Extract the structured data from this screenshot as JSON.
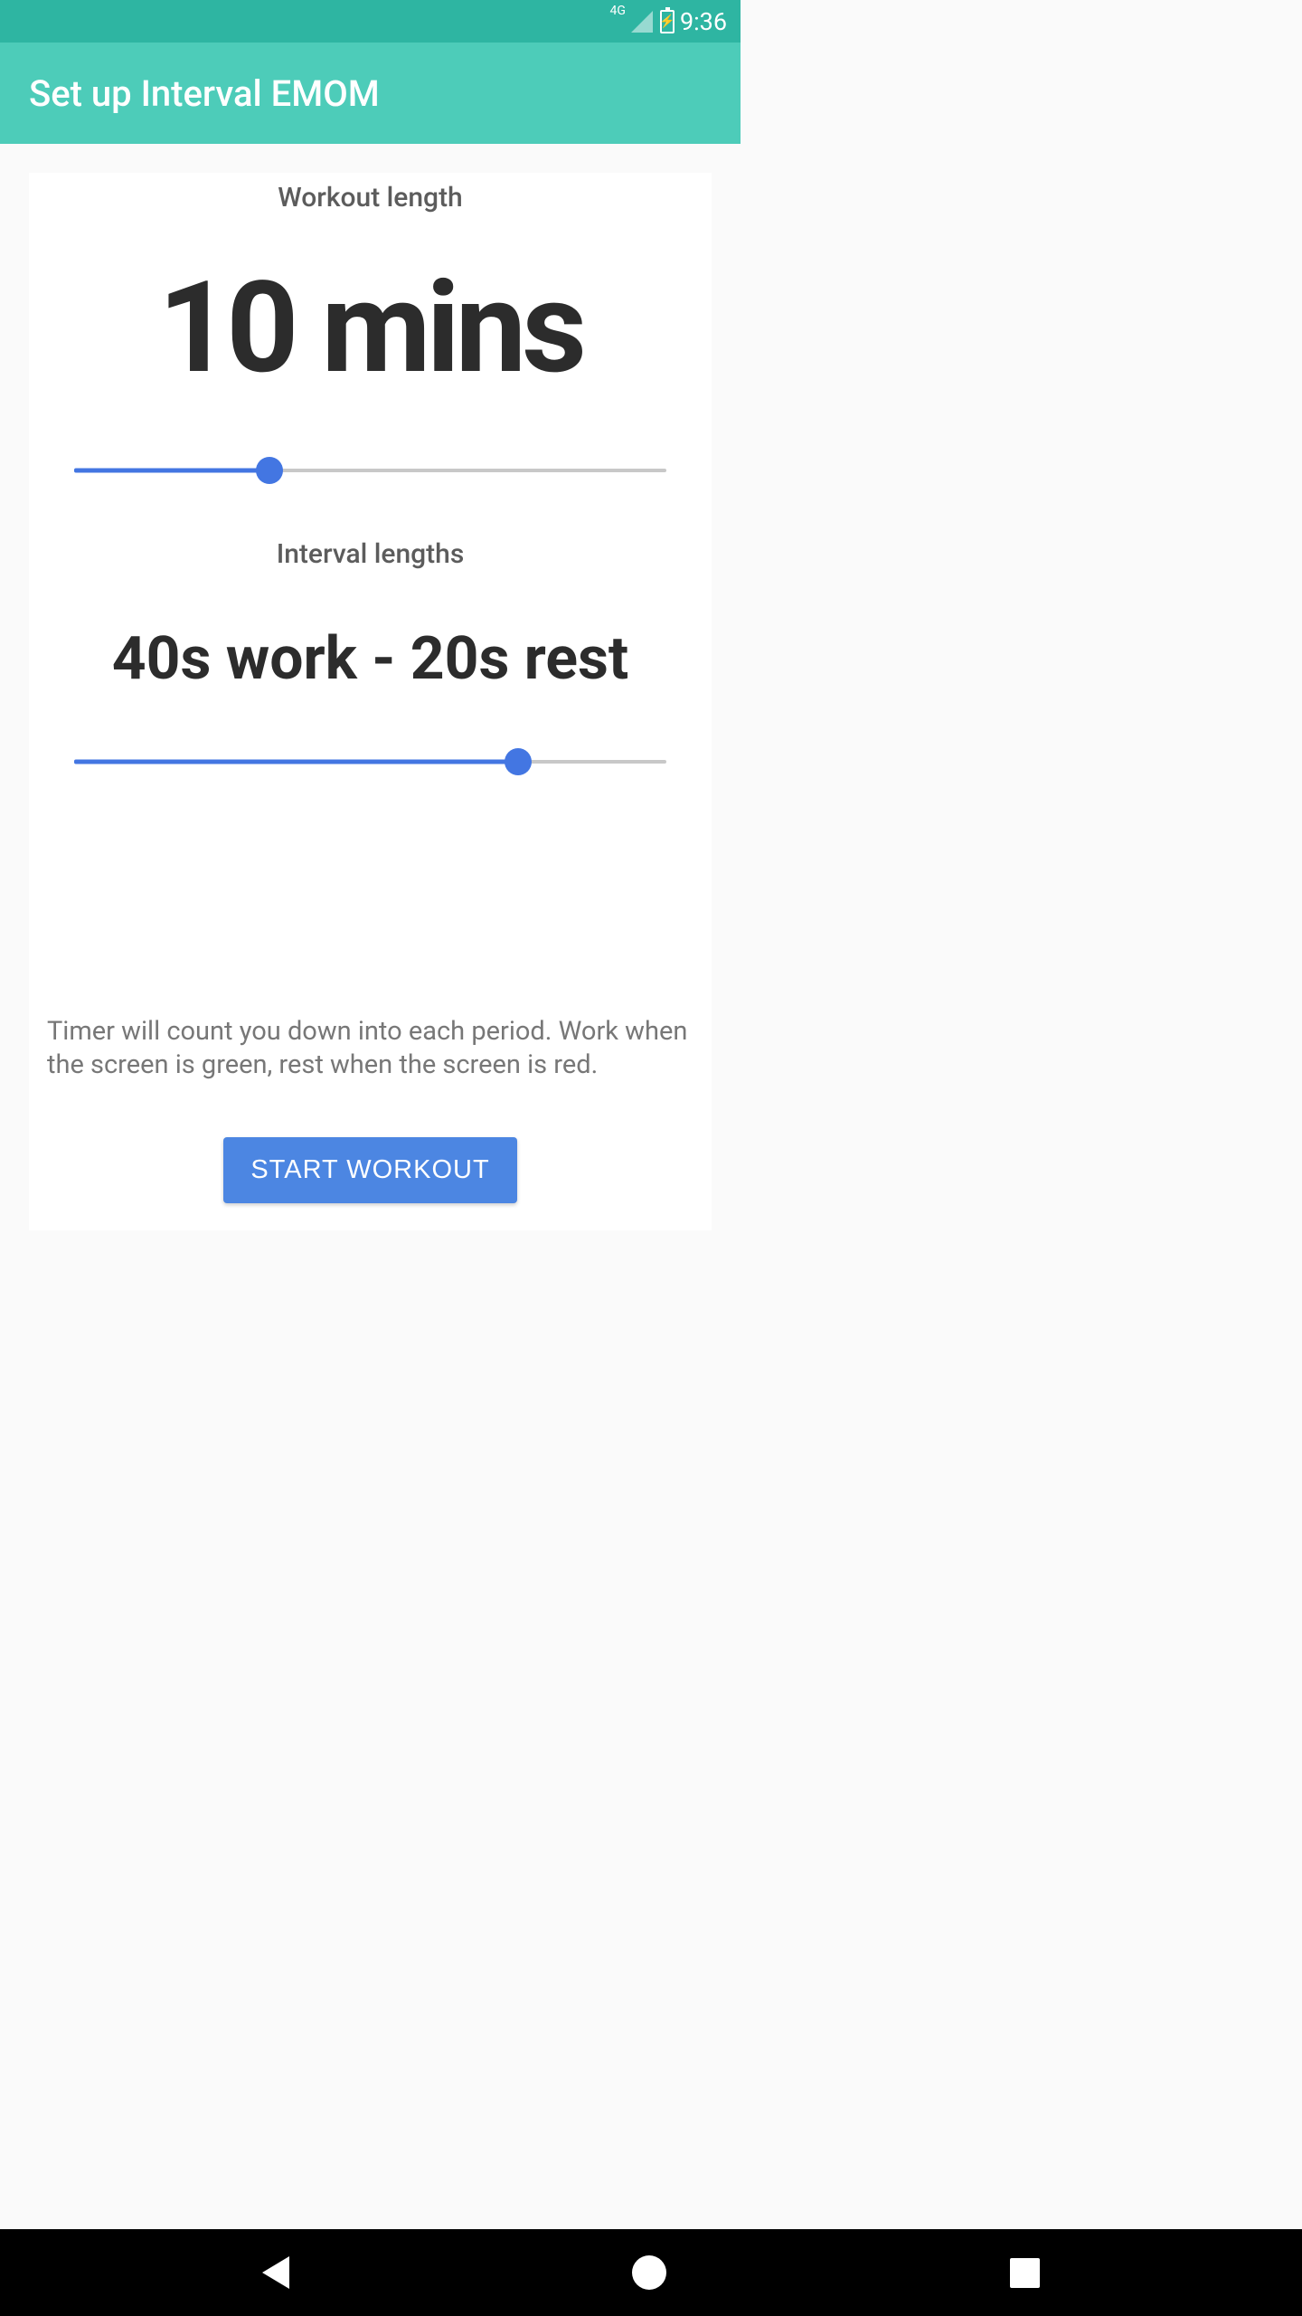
{
  "status_bar": {
    "network_label": "4G",
    "battery_bolt": "⚡",
    "time": "9:36"
  },
  "app_bar": {
    "title": "Set up Interval EMOM"
  },
  "workout_length": {
    "label": "Workout length",
    "value": "10 mins",
    "slider_percent": 33
  },
  "interval_lengths": {
    "label": "Interval lengths",
    "value": "40s work - 20s rest",
    "slider_percent": 75
  },
  "description": "Timer will count you down into each period. Work when the screen is green, rest when the screen is red.",
  "button": {
    "start_label": "START WORKOUT"
  }
}
